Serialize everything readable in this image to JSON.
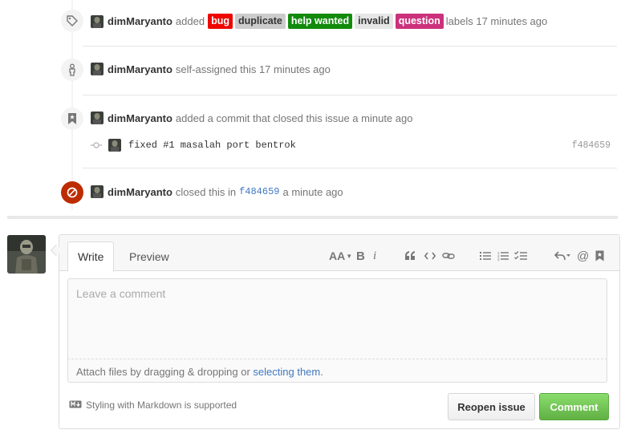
{
  "timeline": {
    "labels_event": {
      "author": "dimMaryanto",
      "action": "added",
      "labels": [
        {
          "name": "bug",
          "bg": "#ee0701",
          "fg": "#ffffff"
        },
        {
          "name": "duplicate",
          "bg": "#cccccc",
          "fg": "#333333"
        },
        {
          "name": "help wanted",
          "bg": "#128a0c",
          "fg": "#ffffff"
        },
        {
          "name": "invalid",
          "bg": "#e6e6e6",
          "fg": "#333333"
        },
        {
          "name": "question",
          "bg": "#cc317c",
          "fg": "#ffffff"
        }
      ],
      "suffix": "labels 17 minutes ago"
    },
    "assign_event": {
      "author": "dimMaryanto",
      "text": "self-assigned this 17 minutes ago"
    },
    "commit_event": {
      "author": "dimMaryanto",
      "text": "added a commit that closed this issue a minute ago",
      "commit_message": "fixed #1 masalah port bentrok",
      "commit_sha": "f484659"
    },
    "closed_event": {
      "author": "dimMaryanto",
      "text_before": "closed this in",
      "sha": "f484659",
      "text_after": "a minute ago"
    }
  },
  "comment_form": {
    "tabs": {
      "write": "Write",
      "preview": "Preview"
    },
    "toolbar": {
      "heading": "AA",
      "bold": "B",
      "italic": "i",
      "mention": "@"
    },
    "placeholder": "Leave a comment",
    "attach_text": "Attach files by dragging & dropping or ",
    "attach_link": "selecting them",
    "attach_end": ".",
    "markdown_note": "Styling with Markdown is supported",
    "reopen_button": "Reopen issue",
    "comment_button": "Comment"
  },
  "colors": {
    "link": "#4078c0",
    "closed_badge": "#bd2c00",
    "comment_button": "#6cc644"
  }
}
